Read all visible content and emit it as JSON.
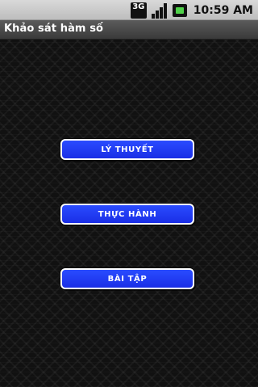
{
  "status_bar": {
    "network_label": "3G",
    "time": "10:59 AM",
    "icons": [
      "network-3g-icon",
      "signal-icon",
      "battery-icon"
    ],
    "colors": {
      "background": "#c8c8c8",
      "battery_fill": "#50d24a"
    }
  },
  "title_bar": {
    "title": "Khảo sát hàm số"
  },
  "menu": {
    "buttons": [
      {
        "label": "LÝ THUYẾT"
      },
      {
        "label": "THỰC HÀNH"
      },
      {
        "label": "BÀI TẬP"
      }
    ],
    "colors": {
      "button_fill": "#1f3cf5",
      "button_border": "#ffffff",
      "button_text": "#ffffff"
    }
  }
}
